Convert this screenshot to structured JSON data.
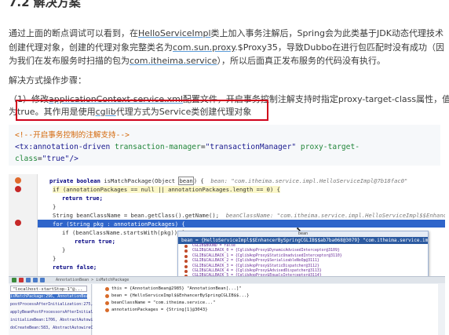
{
  "section": {
    "heading": "7.2 解决方案"
  },
  "intro": {
    "line1_a": "通过上面的断点调试可以看到，在",
    "line1_link": "HelloServiceImpl",
    "line1_b": "类上加入事务注解后，Spring会为此类基于JDK动态代理技术",
    "line2_a": "创建代理对象，创建的代理对象完整类名为",
    "line2_link": "com.sun.proxy",
    "line2_b": ".$Proxy35，导致Dubbo在进行包匹配时没有成功（因",
    "line3_a": "为我们在发布服务时扫描的包为",
    "line3_link": "com.itheima.service",
    "line3_b": "），所以后面真正发布服务的代码没有执行。"
  },
  "solution_label": "解决方式操作步骤：",
  "step1": {
    "line1_a": "（1）修改",
    "line1_link": "applicationContext-service.xml",
    "line1_b": "配置文件，开启事务控制注解支持时指定proxy-target-class属性，值",
    "line2_a": "为true。其作用是使用",
    "line2_link": "cglib",
    "line2_b": "代理方式为Service类创建代理对象"
  },
  "code_block": {
    "comment": "<!--开启事务控制的注解支持-->",
    "tag_open": "<tx:annotation-driven",
    "attr1": "transaction-manager",
    "val1": "\"transactionManager\"",
    "attr2": "proxy-target-",
    "attr2b": "class",
    "val2": "\"true\"",
    "tag_close": "/>"
  },
  "ide": {
    "code_lines": {
      "l1_kw": "private boolean",
      "l1_sig": " isMatchPackage(Object ",
      "l1_bean": "bean",
      "l1_end": ") {",
      "l1_hint": "bean: \"com.itheima.service.impl.HelloServiceImpl@7b18fac0\"",
      "l2": "if (annotationPackages == null || annotationPackages.length == 0) {",
      "l3": "return true;",
      "l4": "}",
      "l5": "String beanClassName = bean.getClass().getName();",
      "l5_hint": "beanClassName: \"com.itheima.service.impl.HelloServiceImpl$$EnhancerBySp",
      "l6": "for (String pkg : annotationPackages) {",
      "l7": "if (beanClassName.startsWith(pkg)) {",
      "l8": "return true;",
      "l9": "}",
      "l10": "}",
      "l11": "return false;"
    },
    "popup": {
      "title": "bean",
      "header": "bean = {HelloServiceImpl$$EnhancerBySpringCGLIB$$ab7ba068@3079} \"com.itheima.service.impl.HelloServiceImpl@7b18fac0\"",
      "rows": [
        "CGLIB$BOUND = false",
        "CGLIB$CALLBACK_0 = {CglibAopProxy$DynamicAdvisedInterceptor@3109}",
        "CGLIB$CALLBACK_1 = {CglibAopProxy$StaticUnadvisedInterceptor@3110}",
        "CGLIB$CALLBACK_2 = {CglibAopProxy$SerializableNoOp@3111}",
        "CGLIB$CALLBACK_3 = {CglibAopProxy$StaticDispatcher@3112}",
        "CGLIB$CALLBACK_4 = {CglibAopProxy$AdvisedDispatcher@3113}",
        "CGLIB$CALLBACK_5 = {CglibAopProxy$EqualsInterceptor@3114}",
        "CGLIB$CALLBACK_6 = {CglibAopProxy$HashCodeInterceptor@3115}"
      ]
    },
    "frames": {
      "selector": "\"localhost-startStop-1\"@...",
      "rows": [
        "isMatchPackage:296, AnnotationBean (com.al",
        "postProcessAfterInitialization:275, Anno",
        "applyBeanPostProcessorsAfterInitialization",
        "initializeBean:1706, AbstractAutowireCapabl",
        "doCreateBean:583, AbstractAutowireCapableBe"
      ]
    },
    "variables": [
      "this = {AnnotationBean@2985} \"AnnotationBean[...]\"",
      "bean = {HelloServiceImpl$$EnhancerBySpringCGLIB$$...}",
      "beanClassName = \"com.itheima.service...\"",
      "annotationPackages = {String[1]@3043}"
    ],
    "bottom_left_text": "AnnotationBean > isMatchPackage"
  }
}
